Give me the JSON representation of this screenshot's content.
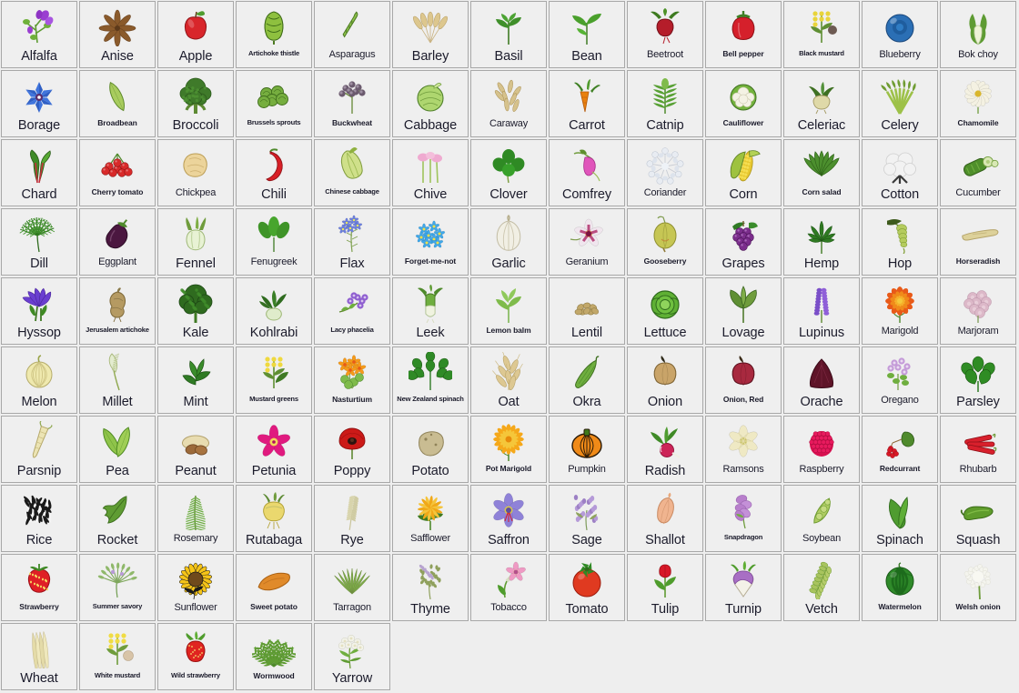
{
  "page": {
    "title": "Plant thumbnail grid",
    "background_color": "#eeeeee",
    "cell_background": "#efefef",
    "cell_border_color": "#a8a8a8",
    "columns": 13,
    "rows": 9,
    "item_count": 100
  },
  "items": [
    {
      "label": "Alfalfa",
      "icon": "alfalfa-icon",
      "size": "lg"
    },
    {
      "label": "Anise",
      "icon": "anise-icon",
      "size": "lg"
    },
    {
      "label": "Apple",
      "icon": "apple-icon",
      "size": "lg"
    },
    {
      "label": "Artichoke thistle",
      "icon": "artichoke-thistle-icon",
      "size": "xs"
    },
    {
      "label": "Asparagus",
      "icon": "asparagus-icon",
      "size": "md"
    },
    {
      "label": "Barley",
      "icon": "barley-icon",
      "size": "lg"
    },
    {
      "label": "Basil",
      "icon": "basil-icon",
      "size": "lg"
    },
    {
      "label": "Bean",
      "icon": "bean-icon",
      "size": "lg"
    },
    {
      "label": "Beetroot",
      "icon": "beetroot-icon",
      "size": "md"
    },
    {
      "label": "Bell pepper",
      "icon": "bell-pepper-icon",
      "size": "sm"
    },
    {
      "label": "Black mustard",
      "icon": "black-mustard-icon",
      "size": "xs"
    },
    {
      "label": "Blueberry",
      "icon": "blueberry-icon",
      "size": "md"
    },
    {
      "label": "Bok choy",
      "icon": "bok-choy-icon",
      "size": "md"
    },
    {
      "label": "Borage",
      "icon": "borage-icon",
      "size": "lg"
    },
    {
      "label": "Broadbean",
      "icon": "broadbean-icon",
      "size": "sm"
    },
    {
      "label": "Broccoli",
      "icon": "broccoli-icon",
      "size": "lg"
    },
    {
      "label": "Brussels sprouts",
      "icon": "brussels-sprouts-icon",
      "size": "xs"
    },
    {
      "label": "Buckwheat",
      "icon": "buckwheat-icon",
      "size": "sm"
    },
    {
      "label": "Cabbage",
      "icon": "cabbage-icon",
      "size": "lg"
    },
    {
      "label": "Caraway",
      "icon": "caraway-icon",
      "size": "md"
    },
    {
      "label": "Carrot",
      "icon": "carrot-icon",
      "size": "lg"
    },
    {
      "label": "Catnip",
      "icon": "catnip-icon",
      "size": "lg"
    },
    {
      "label": "Cauliflower",
      "icon": "cauliflower-icon",
      "size": "sm"
    },
    {
      "label": "Celeriac",
      "icon": "celeriac-icon",
      "size": "lg"
    },
    {
      "label": "Celery",
      "icon": "celery-icon",
      "size": "lg"
    },
    {
      "label": "Chamomile",
      "icon": "chamomile-icon",
      "size": "sm"
    },
    {
      "label": "Chard",
      "icon": "chard-icon",
      "size": "lg"
    },
    {
      "label": "Cherry tomato",
      "icon": "cherry-tomato-icon",
      "size": "sm"
    },
    {
      "label": "Chickpea",
      "icon": "chickpea-icon",
      "size": "md"
    },
    {
      "label": "Chili",
      "icon": "chili-icon",
      "size": "lg"
    },
    {
      "label": "Chinese cabbage",
      "icon": "chinese-cabbage-icon",
      "size": "xs"
    },
    {
      "label": "Chive",
      "icon": "chive-icon",
      "size": "lg"
    },
    {
      "label": "Clover",
      "icon": "clover-icon",
      "size": "lg"
    },
    {
      "label": "Comfrey",
      "icon": "comfrey-icon",
      "size": "lg"
    },
    {
      "label": "Coriander",
      "icon": "coriander-icon",
      "size": "md"
    },
    {
      "label": "Corn",
      "icon": "corn-icon",
      "size": "lg"
    },
    {
      "label": "Corn salad",
      "icon": "corn-salad-icon",
      "size": "sm"
    },
    {
      "label": "Cotton",
      "icon": "cotton-icon",
      "size": "lg"
    },
    {
      "label": "Cucumber",
      "icon": "cucumber-icon",
      "size": "md"
    },
    {
      "label": "Dill",
      "icon": "dill-icon",
      "size": "lg"
    },
    {
      "label": "Eggplant",
      "icon": "eggplant-icon",
      "size": "md"
    },
    {
      "label": "Fennel",
      "icon": "fennel-icon",
      "size": "lg"
    },
    {
      "label": "Fenugreek",
      "icon": "fenugreek-icon",
      "size": "md"
    },
    {
      "label": "Flax",
      "icon": "flax-icon",
      "size": "lg"
    },
    {
      "label": "Forget-me-not",
      "icon": "forget-me-not-icon",
      "size": "sm"
    },
    {
      "label": "Garlic",
      "icon": "garlic-icon",
      "size": "lg"
    },
    {
      "label": "Geranium",
      "icon": "geranium-icon",
      "size": "md"
    },
    {
      "label": "Gooseberry",
      "icon": "gooseberry-icon",
      "size": "sm"
    },
    {
      "label": "Grapes",
      "icon": "grapes-icon",
      "size": "lg"
    },
    {
      "label": "Hemp",
      "icon": "hemp-icon",
      "size": "lg"
    },
    {
      "label": "Hop",
      "icon": "hop-icon",
      "size": "lg"
    },
    {
      "label": "Horseradish",
      "icon": "horseradish-icon",
      "size": "sm"
    },
    {
      "label": "Hyssop",
      "icon": "hyssop-icon",
      "size": "lg"
    },
    {
      "label": "Jerusalem artichoke",
      "icon": "jerusalem-artichoke-icon",
      "size": "xs"
    },
    {
      "label": "Kale",
      "icon": "kale-icon",
      "size": "lg"
    },
    {
      "label": "Kohlrabi",
      "icon": "kohlrabi-icon",
      "size": "lg"
    },
    {
      "label": "Lacy phacelia",
      "icon": "lacy-phacelia-icon",
      "size": "xs"
    },
    {
      "label": "Leek",
      "icon": "leek-icon",
      "size": "lg"
    },
    {
      "label": "Lemon balm",
      "icon": "lemon-balm-icon",
      "size": "sm"
    },
    {
      "label": "Lentil",
      "icon": "lentil-icon",
      "size": "lg"
    },
    {
      "label": "Lettuce",
      "icon": "lettuce-icon",
      "size": "lg"
    },
    {
      "label": "Lovage",
      "icon": "lovage-icon",
      "size": "lg"
    },
    {
      "label": "Lupinus",
      "icon": "lupinus-icon",
      "size": "lg"
    },
    {
      "label": "Marigold",
      "icon": "marigold-icon",
      "size": "md"
    },
    {
      "label": "Marjoram",
      "icon": "marjoram-icon",
      "size": "md"
    },
    {
      "label": "Melon",
      "icon": "melon-icon",
      "size": "lg"
    },
    {
      "label": "Millet",
      "icon": "millet-icon",
      "size": "lg"
    },
    {
      "label": "Mint",
      "icon": "mint-icon",
      "size": "lg"
    },
    {
      "label": "Mustard greens",
      "icon": "mustard-greens-icon",
      "size": "xs"
    },
    {
      "label": "Nasturtium",
      "icon": "nasturtium-icon",
      "size": "sm"
    },
    {
      "label": "New Zealand spinach",
      "icon": "new-zealand-spinach-icon",
      "size": "xs"
    },
    {
      "label": "Oat",
      "icon": "oat-icon",
      "size": "lg"
    },
    {
      "label": "Okra",
      "icon": "okra-icon",
      "size": "lg"
    },
    {
      "label": "Onion",
      "icon": "onion-icon",
      "size": "lg"
    },
    {
      "label": "Onion, Red",
      "icon": "onion-red-icon",
      "size": "sm"
    },
    {
      "label": "Orache",
      "icon": "orache-icon",
      "size": "lg"
    },
    {
      "label": "Oregano",
      "icon": "oregano-icon",
      "size": "md"
    },
    {
      "label": "Parsley",
      "icon": "parsley-icon",
      "size": "lg"
    },
    {
      "label": "Parsnip",
      "icon": "parsnip-icon",
      "size": "lg"
    },
    {
      "label": "Pea",
      "icon": "pea-icon",
      "size": "lg"
    },
    {
      "label": "Peanut",
      "icon": "peanut-icon",
      "size": "lg"
    },
    {
      "label": "Petunia",
      "icon": "petunia-icon",
      "size": "lg"
    },
    {
      "label": "Poppy",
      "icon": "poppy-icon",
      "size": "lg"
    },
    {
      "label": "Potato",
      "icon": "potato-icon",
      "size": "lg"
    },
    {
      "label": "Pot Marigold",
      "icon": "pot-marigold-icon",
      "size": "sm"
    },
    {
      "label": "Pumpkin",
      "icon": "pumpkin-icon",
      "size": "md"
    },
    {
      "label": "Radish",
      "icon": "radish-icon",
      "size": "lg"
    },
    {
      "label": "Ramsons",
      "icon": "ramsons-icon",
      "size": "md"
    },
    {
      "label": "Raspberry",
      "icon": "raspberry-icon",
      "size": "md"
    },
    {
      "label": "Redcurrant",
      "icon": "redcurrant-icon",
      "size": "sm"
    },
    {
      "label": "Rhubarb",
      "icon": "rhubarb-icon",
      "size": "md"
    },
    {
      "label": "Rice",
      "icon": "rice-icon",
      "size": "lg"
    },
    {
      "label": "Rocket",
      "icon": "rocket-icon",
      "size": "lg"
    },
    {
      "label": "Rosemary",
      "icon": "rosemary-icon",
      "size": "md"
    },
    {
      "label": "Rutabaga",
      "icon": "rutabaga-icon",
      "size": "lg"
    },
    {
      "label": "Rye",
      "icon": "rye-icon",
      "size": "lg"
    },
    {
      "label": "Safflower",
      "icon": "safflower-icon",
      "size": "md"
    },
    {
      "label": "Saffron",
      "icon": "saffron-icon",
      "size": "lg"
    },
    {
      "label": "Sage",
      "icon": "sage-icon",
      "size": "lg"
    },
    {
      "label": "Shallot",
      "icon": "shallot-icon",
      "size": "lg"
    },
    {
      "label": "Snapdragon",
      "icon": "snapdragon-icon",
      "size": "xs"
    },
    {
      "label": "Soybean",
      "icon": "soybean-icon",
      "size": "md"
    },
    {
      "label": "Spinach",
      "icon": "spinach-icon",
      "size": "lg"
    },
    {
      "label": "Squash",
      "icon": "squash-icon",
      "size": "lg"
    },
    {
      "label": "Strawberry",
      "icon": "strawberry-icon",
      "size": "sm"
    },
    {
      "label": "Summer savory",
      "icon": "summer-savory-icon",
      "size": "xs"
    },
    {
      "label": "Sunflower",
      "icon": "sunflower-icon",
      "size": "md"
    },
    {
      "label": "Sweet potato",
      "icon": "sweet-potato-icon",
      "size": "sm"
    },
    {
      "label": "Tarragon",
      "icon": "tarragon-icon",
      "size": "md"
    },
    {
      "label": "Thyme",
      "icon": "thyme-icon",
      "size": "lg"
    },
    {
      "label": "Tobacco",
      "icon": "tobacco-icon",
      "size": "md"
    },
    {
      "label": "Tomato",
      "icon": "tomato-icon",
      "size": "lg"
    },
    {
      "label": "Tulip",
      "icon": "tulip-icon",
      "size": "lg"
    },
    {
      "label": "Turnip",
      "icon": "turnip-icon",
      "size": "lg"
    },
    {
      "label": "Vetch",
      "icon": "vetch-icon",
      "size": "lg"
    },
    {
      "label": "Watermelon",
      "icon": "watermelon-icon",
      "size": "sm"
    },
    {
      "label": "Welsh onion",
      "icon": "welsh-onion-icon",
      "size": "sm"
    },
    {
      "label": "Wheat",
      "icon": "wheat-icon",
      "size": "lg"
    },
    {
      "label": "White mustard",
      "icon": "white-mustard-icon",
      "size": "xs"
    },
    {
      "label": "Wild strawberry",
      "icon": "wild-strawberry-icon",
      "size": "xs"
    },
    {
      "label": "Wormwood",
      "icon": "wormwood-icon",
      "size": "sm"
    },
    {
      "label": "Yarrow",
      "icon": "yarrow-icon",
      "size": "lg"
    }
  ]
}
